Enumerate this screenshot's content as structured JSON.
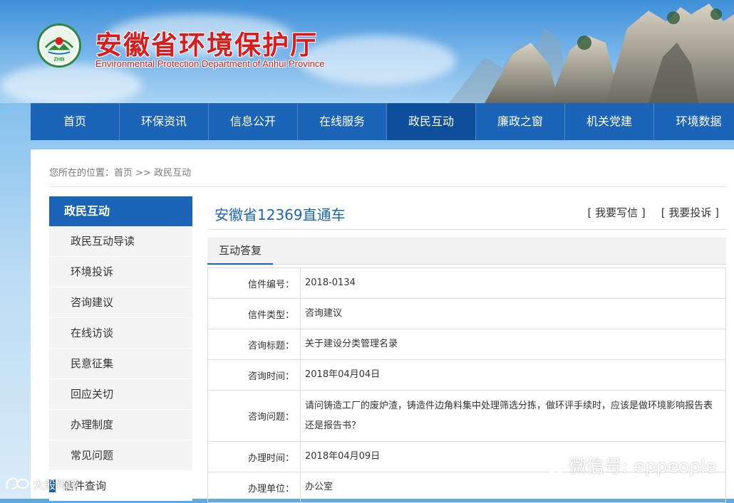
{
  "header": {
    "title_cn": "安徽省环境保护厅",
    "title_en": "Environmental Protection Department of Anhui Province",
    "logo_text": "ZHB"
  },
  "nav": [
    {
      "label": "首页"
    },
    {
      "label": "环保资讯"
    },
    {
      "label": "信息公开"
    },
    {
      "label": "在线服务"
    },
    {
      "label": "政民互动",
      "active": true
    },
    {
      "label": "廉政之窗"
    },
    {
      "label": "机关党建"
    },
    {
      "label": "环境数据"
    }
  ],
  "breadcrumb": {
    "prefix": "您所在的位置：",
    "home": "首页",
    "sep": " >> ",
    "current": "政民互动"
  },
  "sidebar": {
    "heading": "政民互动",
    "items": [
      "政民互动导读",
      "环境投诉",
      "咨询建议",
      "在线访谈",
      "民意征集",
      "回应关切",
      "办理制度",
      "常见问题"
    ],
    "sub_item": "信件查询"
  },
  "main": {
    "title": "安徽省12369直通车",
    "action_write": "[ 我要写信 ]",
    "action_complain": "[ 我要投诉 ]",
    "subtab": "互动答复",
    "rows": [
      {
        "label": "信件编号：",
        "value": "2018-0134"
      },
      {
        "label": "信件类型：",
        "value": "咨询建议"
      },
      {
        "label": "咨询标题：",
        "value": "关于建设分类管理名录"
      },
      {
        "label": "咨询时间：",
        "value": "2018年04月04日"
      },
      {
        "label": "咨询问题：",
        "value": "请问铸造工厂的废炉渣，铸造件边角料集中处理筛选分拣，做环评手续时，应该是做环境影响报告表还是报告书？"
      },
      {
        "label": "办理时间：",
        "value": "2018年04月09日"
      },
      {
        "label": "办理单位：",
        "value": "办公室"
      }
    ]
  },
  "watermarks": {
    "wechat": "微信号: eppeople",
    "left": "大般跨境"
  },
  "colors": {
    "nav_blue": "#1b64b8",
    "title_red": "#d71d1d"
  }
}
